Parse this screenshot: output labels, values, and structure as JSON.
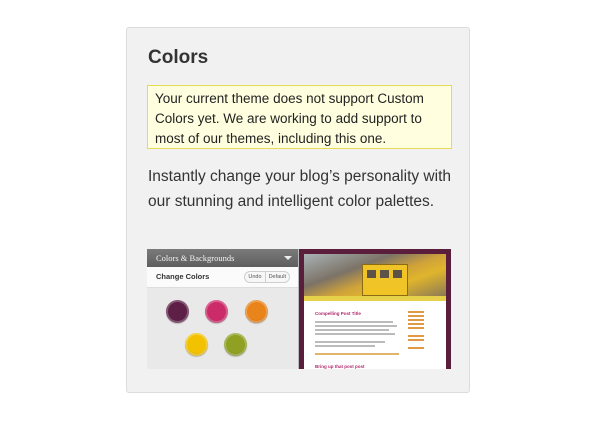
{
  "card": {
    "title": "Colors",
    "notice": "Your current theme does not support Custom Colors yet. We are working to add support to most of our themes, including this one.",
    "description": "Instantly change your blog’s personality with our stunning and intelligent color palettes."
  },
  "preview": {
    "panel_title": "Colors & Backgrounds",
    "subtitle": "Change Colors",
    "undo_label": "Undo",
    "default_label": "Default",
    "swatches": [
      "#5e1f47",
      "#cc2b6a",
      "#e8841a",
      "#f2c200",
      "#8fa022"
    ],
    "post_title": "Compelling Post Title",
    "post_title_2": "Bring up that post post"
  }
}
